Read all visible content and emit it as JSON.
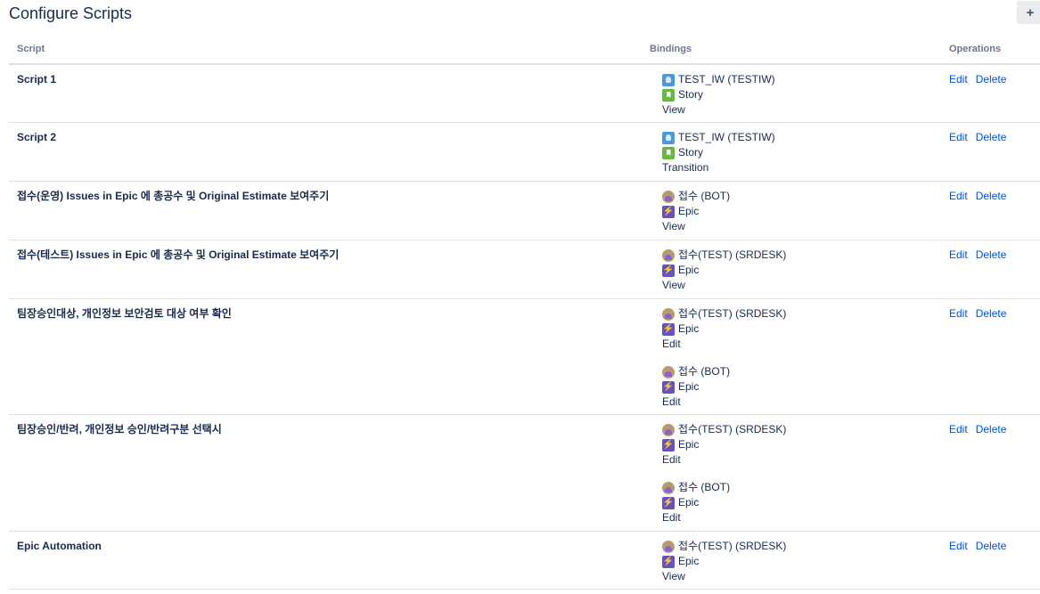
{
  "page": {
    "title": "Configure Scripts",
    "add_label": "+"
  },
  "columns": {
    "script": "Script",
    "bindings": "Bindings",
    "operations": "Operations"
  },
  "operations": {
    "edit": "Edit",
    "delete": "Delete"
  },
  "rows": [
    {
      "name": "Script 1",
      "height": 65,
      "bindings": [
        {
          "project": "TEST_IW (TESTIW)",
          "project_icon": "project-icon",
          "issue_type": "Story",
          "issue_icon": "story-icon",
          "action": "View"
        }
      ]
    },
    {
      "name": "Script 2",
      "height": 65,
      "bindings": [
        {
          "project": "TEST_IW (TESTIW)",
          "project_icon": "project-icon",
          "issue_type": "Story",
          "issue_icon": "story-icon",
          "action": "Transition"
        }
      ]
    },
    {
      "name": "접수(운영) Issues in Epic 에 총공수 및 Original Estimate 보여주기",
      "height": 65,
      "bindings": [
        {
          "project": "접수 (BOT)",
          "project_icon": "avatar-icon",
          "issue_type": "Epic",
          "issue_icon": "epic-icon",
          "action": "View"
        }
      ]
    },
    {
      "name": "접수(테스트) Issues in Epic 에 총공수 및 Original Estimate 보여주기",
      "height": 65,
      "bindings": [
        {
          "project": "접수(TEST) (SRDESK)",
          "project_icon": "avatar-icon",
          "issue_type": "Epic",
          "issue_icon": "epic-icon",
          "action": "View"
        }
      ]
    },
    {
      "name": "팀장승인대상, 개인정보 보안검토 대상 여부 확인",
      "height": 129,
      "bindings": [
        {
          "project": "접수(TEST) (SRDESK)",
          "project_icon": "avatar-icon",
          "issue_type": "Epic",
          "issue_icon": "epic-icon",
          "action": "Edit"
        },
        {
          "project": "접수 (BOT)",
          "project_icon": "avatar-icon",
          "issue_type": "Epic",
          "issue_icon": "epic-icon",
          "action": "Edit"
        }
      ]
    },
    {
      "name": "팀장승인/반려, 개인정보 승인/반려구분 선택시",
      "height": 130,
      "bindings": [
        {
          "project": "접수(TEST) (SRDESK)",
          "project_icon": "avatar-icon",
          "issue_type": "Epic",
          "issue_icon": "epic-icon",
          "action": "Edit"
        },
        {
          "project": "접수 (BOT)",
          "project_icon": "avatar-icon",
          "issue_type": "Epic",
          "issue_icon": "epic-icon",
          "action": "Edit"
        }
      ]
    },
    {
      "name": "Epic Automation",
      "height": 64,
      "bindings": [
        {
          "project": "접수(TEST) (SRDESK)",
          "project_icon": "avatar-icon",
          "issue_type": "Epic",
          "issue_icon": "epic-icon",
          "action": "View"
        }
      ]
    }
  ]
}
